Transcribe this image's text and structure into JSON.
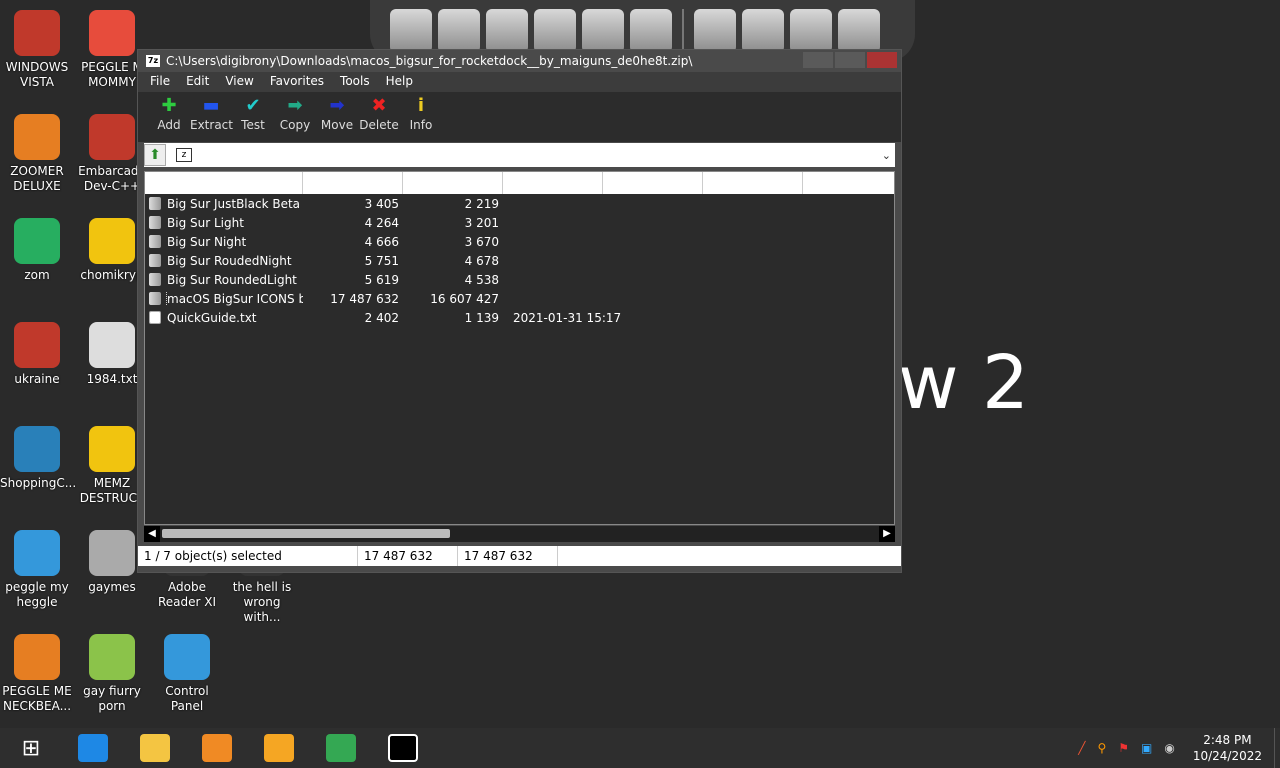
{
  "desktop": {
    "icons": [
      {
        "label": "WINDOWS VISTA",
        "color": "#c0392b"
      },
      {
        "label": "PEGGLE M MOMMY",
        "color": "#e74c3c"
      },
      {
        "label": "ZOOMER DELUXE",
        "color": "#e67e22"
      },
      {
        "label": "Embarcade Dev-C++",
        "color": "#c0392b"
      },
      {
        "label": "zom",
        "color": "#27ae60"
      },
      {
        "label": "chomikryp",
        "color": "#f1c40f"
      },
      {
        "label": "ukraine",
        "color": "#c0392b"
      },
      {
        "label": "1984.txt",
        "color": "#dddddd"
      },
      {
        "label": "ShoppingC...",
        "color": "#2980b9"
      },
      {
        "label": "MEMZ DESTRUCT",
        "color": "#f1c40f"
      },
      {
        "label": "peggle my heggle",
        "color": "#3498db"
      },
      {
        "label": "gaymes",
        "color": "#aaaaaa"
      },
      {
        "label": "Adobe Reader XI",
        "color": "#333333"
      },
      {
        "label": "the hell is wrong with...",
        "color": "#333333"
      },
      {
        "label": "PEGGLE ME NECKBEA...",
        "color": "#e67e22"
      },
      {
        "label": "gay fiurry porn",
        "color": "#8bc34a"
      },
      {
        "label": "Control Panel",
        "color": "#3498db"
      }
    ],
    "watermark": "w 2"
  },
  "window": {
    "title": "C:\\Users\\digibrony\\Downloads\\macos_bigsur_for_rocketdock__by_maiguns_de0he8t.zip\\",
    "menu": [
      "File",
      "Edit",
      "View",
      "Favorites",
      "Tools",
      "Help"
    ],
    "toolbar": [
      {
        "label": "Add",
        "glyph": "✚",
        "color": "#2ecc40"
      },
      {
        "label": "Extract",
        "glyph": "▬",
        "color": "#2255ee"
      },
      {
        "label": "Test",
        "glyph": "✔",
        "color": "#22cccc"
      },
      {
        "label": "Copy",
        "glyph": "➡",
        "color": "#22aa88"
      },
      {
        "label": "Move",
        "glyph": "➡",
        "color": "#2233cc"
      },
      {
        "label": "Delete",
        "glyph": "✖",
        "color": "#ee2222"
      },
      {
        "label": "Info",
        "glyph": "i",
        "color": "#eecc22"
      }
    ],
    "files": [
      {
        "name": "Big Sur JustBlack Beta",
        "size": "3 405",
        "packed": "2 219",
        "modified": "",
        "type": "folder"
      },
      {
        "name": "Big Sur Light",
        "size": "4 264",
        "packed": "3 201",
        "modified": "",
        "type": "folder"
      },
      {
        "name": "Big Sur Night",
        "size": "4 666",
        "packed": "3 670",
        "modified": "",
        "type": "folder"
      },
      {
        "name": "Big Sur RoudedNight",
        "size": "5 751",
        "packed": "4 678",
        "modified": "",
        "type": "folder"
      },
      {
        "name": "Big Sur RoundedLight",
        "size": "5 619",
        "packed": "4 538",
        "modified": "",
        "type": "folder"
      },
      {
        "name": "macOS BigSur ICONS b...",
        "size": "17 487 632",
        "packed": "16 607 427",
        "modified": "",
        "type": "folder",
        "selected": true
      },
      {
        "name": "QuickGuide.txt",
        "size": "2 402",
        "packed": "1 139",
        "modified": "2021-01-31 15:17",
        "type": "txt"
      }
    ],
    "status": {
      "selection": "1 / 7 object(s) selected",
      "size": "17 487 632",
      "packed": "17 487 632"
    }
  },
  "taskbar": {
    "apps": [
      {
        "name": "internet-explorer",
        "color": "#1e88e5"
      },
      {
        "name": "file-explorer",
        "color": "#f4c542"
      },
      {
        "name": "media-player",
        "color": "#f08a24"
      },
      {
        "name": "uc-browser",
        "color": "#f5a623"
      },
      {
        "name": "chrome",
        "color": "#34a853"
      },
      {
        "name": "7zip",
        "color": "#000000"
      }
    ],
    "time": "2:48 PM",
    "date": "10/24/2022"
  }
}
